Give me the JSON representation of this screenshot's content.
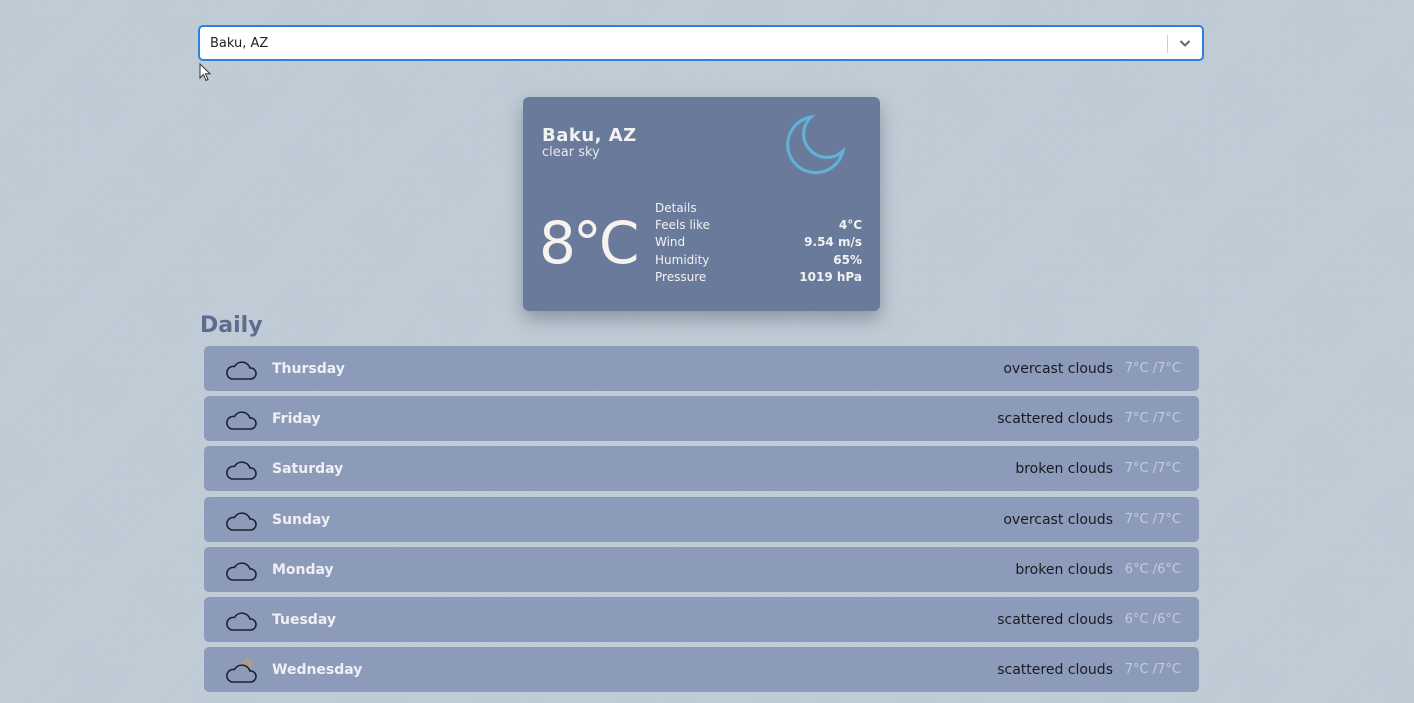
{
  "search": {
    "value": "Baku, AZ"
  },
  "current": {
    "city": "Baku, AZ",
    "description": "clear sky",
    "icon": "moon-icon",
    "temperature": "8°C",
    "details_label": "Details",
    "details": [
      {
        "label": "Feels like",
        "value": "4°C"
      },
      {
        "label": "Wind",
        "value": "9.54 m/s"
      },
      {
        "label": "Humidity",
        "value": "65%"
      },
      {
        "label": "Pressure",
        "value": "1019 hPa"
      }
    ]
  },
  "daily": {
    "title": "Daily",
    "items": [
      {
        "day": "Thursday",
        "description": "overcast clouds",
        "temp": "7°C /7°C",
        "icon": "cloud-icon"
      },
      {
        "day": "Friday",
        "description": "scattered clouds",
        "temp": "7°C /7°C",
        "icon": "cloud-icon"
      },
      {
        "day": "Saturday",
        "description": "broken clouds",
        "temp": "7°C /7°C",
        "icon": "cloud-icon"
      },
      {
        "day": "Sunday",
        "description": "overcast clouds",
        "temp": "7°C /7°C",
        "icon": "cloud-icon"
      },
      {
        "day": "Monday",
        "description": "broken clouds",
        "temp": "6°C /6°C",
        "icon": "cloud-icon"
      },
      {
        "day": "Tuesday",
        "description": "scattered clouds",
        "temp": "6°C /6°C",
        "icon": "cloud-icon"
      },
      {
        "day": "Wednesday",
        "description": "scattered clouds",
        "temp": "7°C /7°C",
        "icon": "cloud-sun-icon"
      }
    ]
  },
  "colors": {
    "background": "#c0ccd6",
    "card": "#6a7a9b",
    "row": "#8d9bba",
    "moon": "#5fb3d6",
    "focus": "#2f7fe0",
    "sun": "#e0a040"
  }
}
